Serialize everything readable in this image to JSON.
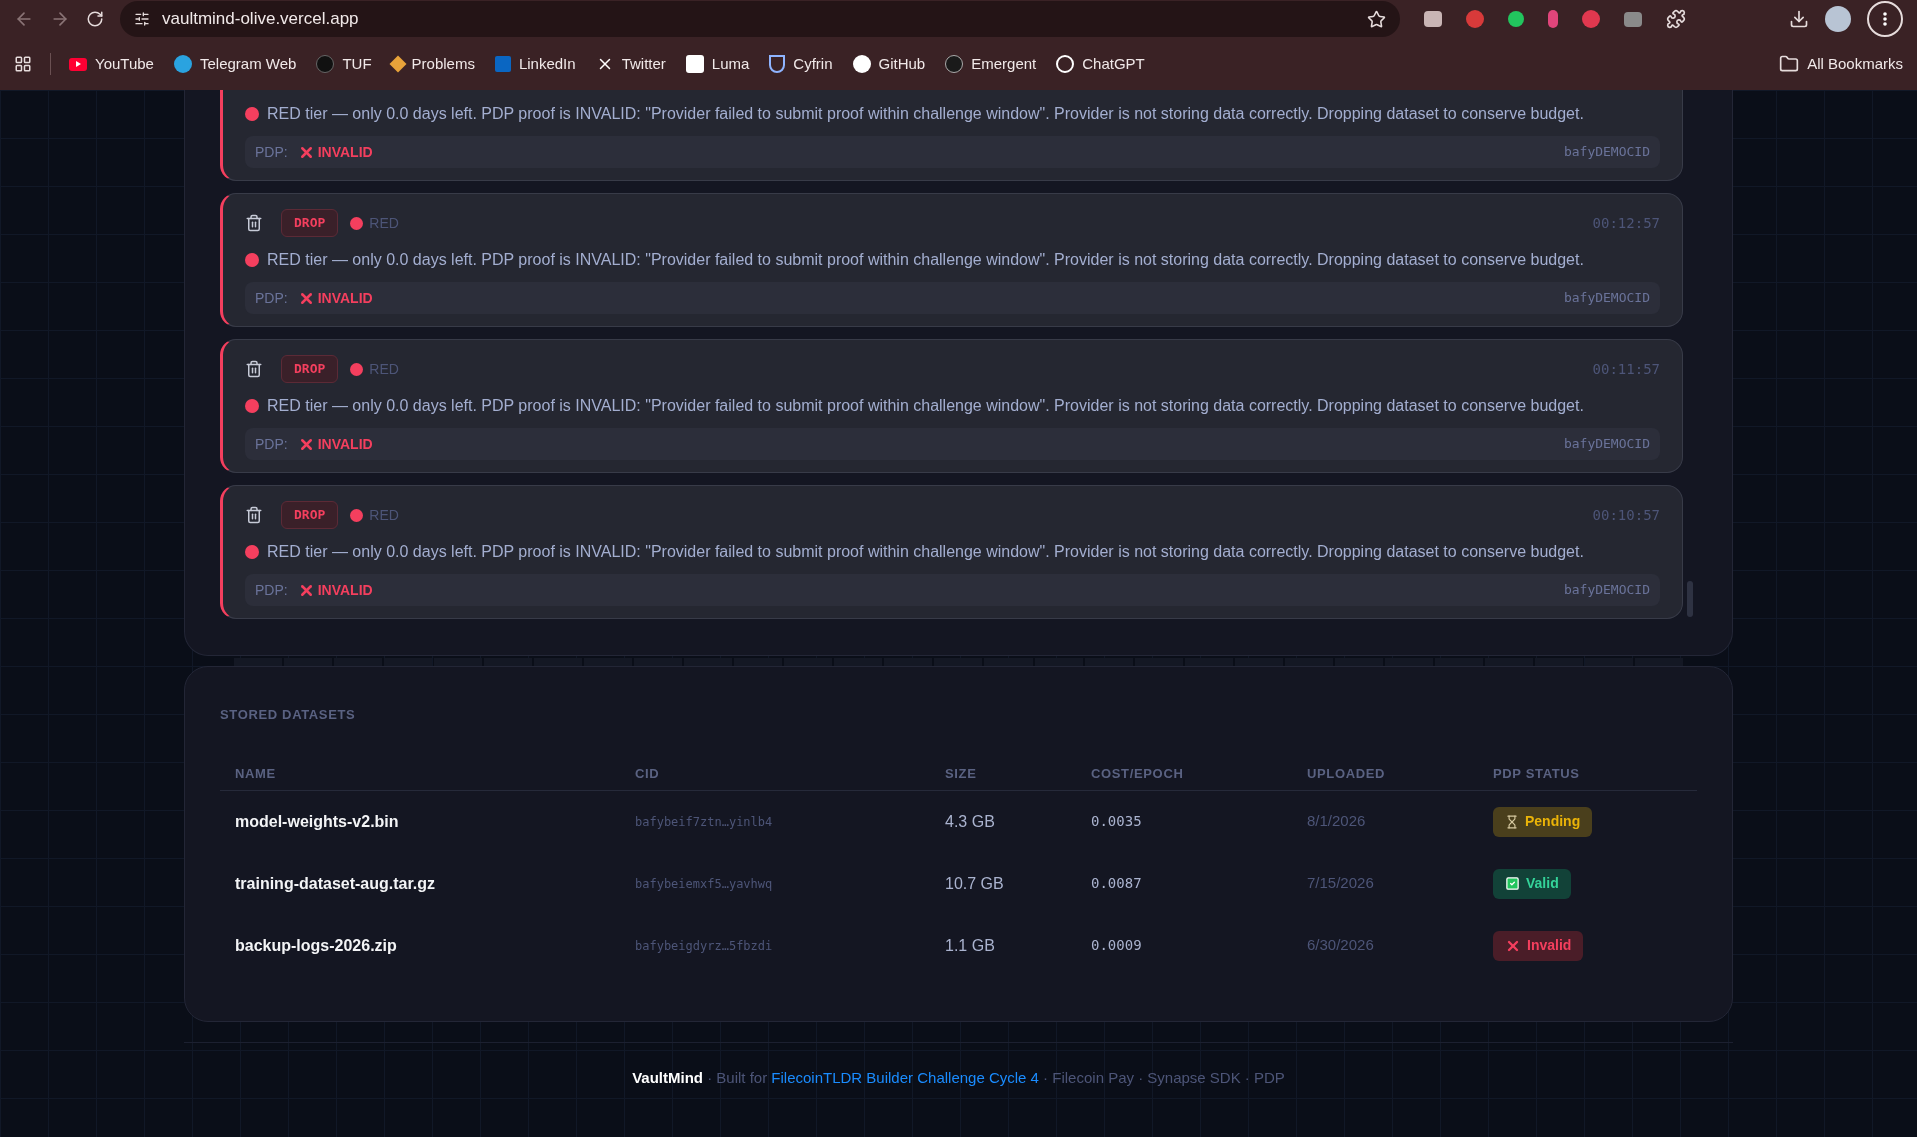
{
  "browser": {
    "url": "vaultmind-olive.vercel.app",
    "bookmarks": [
      {
        "label": "YouTube"
      },
      {
        "label": "Telegram Web"
      },
      {
        "label": "TUF"
      },
      {
        "label": "Problems"
      },
      {
        "label": "LinkedIn"
      },
      {
        "label": "Twitter"
      },
      {
        "label": "Luma"
      },
      {
        "label": "Cyfrin"
      },
      {
        "label": "GitHub"
      },
      {
        "label": "Emergent"
      },
      {
        "label": "ChatGPT"
      }
    ],
    "all_bookmarks": "All Bookmarks"
  },
  "log": {
    "entries": [
      {
        "kind": "partial",
        "message": "RED tier — only 0.0 days left. PDP proof is INVALID: \"Provider failed to submit proof within challenge window\". Provider is not storing data correctly. Dropping dataset to conserve budget.",
        "pdp_label": "PDP:",
        "pdp": "INVALID",
        "cid": "bafyDEMOCID"
      },
      {
        "kind": "full",
        "action": "DROP",
        "tier": "RED",
        "time": "00:12:57",
        "message": "RED tier — only 0.0 days left. PDP proof is INVALID: \"Provider failed to submit proof within challenge window\". Provider is not storing data correctly. Dropping dataset to conserve budget.",
        "pdp_label": "PDP:",
        "pdp": "INVALID",
        "cid": "bafyDEMOCID"
      },
      {
        "kind": "full",
        "action": "DROP",
        "tier": "RED",
        "time": "00:11:57",
        "message": "RED tier — only 0.0 days left. PDP proof is INVALID: \"Provider failed to submit proof within challenge window\". Provider is not storing data correctly. Dropping dataset to conserve budget.",
        "pdp_label": "PDP:",
        "pdp": "INVALID",
        "cid": "bafyDEMOCID"
      },
      {
        "kind": "full",
        "action": "DROP",
        "tier": "RED",
        "time": "00:10:57",
        "message": "RED tier — only 0.0 days left. PDP proof is INVALID: \"Provider failed to submit proof within challenge window\". Provider is not storing data correctly. Dropping dataset to conserve budget.",
        "pdp_label": "PDP:",
        "pdp": "INVALID",
        "cid": "bafyDEMOCID"
      }
    ]
  },
  "datasets": {
    "title": "STORED DATASETS",
    "columns": [
      "NAME",
      "CID",
      "SIZE",
      "COST/EPOCH",
      "UPLOADED",
      "PDP STATUS"
    ],
    "rows": [
      {
        "name": "model-weights-v2.bin",
        "cid": "bafybeif7ztn…yinlb4",
        "size": "4.3 GB",
        "cost": "0.0035",
        "uploaded": "8/1/2026",
        "status": {
          "kind": "pending",
          "label": "Pending"
        }
      },
      {
        "name": "training-dataset-aug.tar.gz",
        "cid": "bafybeiemxf5…yavhwq",
        "size": "10.7 GB",
        "cost": "0.0087",
        "uploaded": "7/15/2026",
        "status": {
          "kind": "valid",
          "label": "Valid"
        }
      },
      {
        "name": "backup-logs-2026.zip",
        "cid": "bafybeigdyrz…5fbzdi",
        "size": "1.1 GB",
        "cost": "0.0009",
        "uploaded": "6/30/2026",
        "status": {
          "kind": "invalid",
          "label": "Invalid"
        }
      }
    ]
  },
  "footer": {
    "brand": "VaultMind",
    "pre": " · Built for ",
    "link": "FilecoinTLDR Builder Challenge Cycle 4",
    "post": " · Filecoin Pay · Synapse SDK · PDP"
  }
}
